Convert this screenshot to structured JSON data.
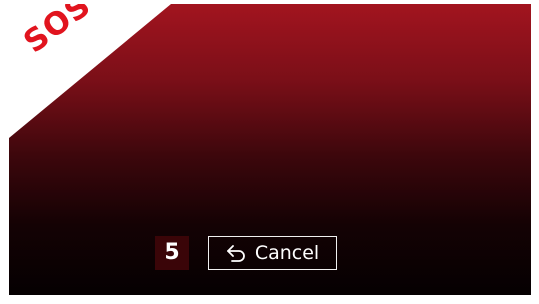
{
  "sos": {
    "label": "SOS",
    "label_color": "#e1141e",
    "banner_color": "#ffffff"
  },
  "countdown": {
    "value": "5"
  },
  "cancel": {
    "label": "Cancel",
    "icon": "undo-arrow-icon"
  },
  "colors": {
    "background_top": "#a2141f",
    "background_bottom": "#050001",
    "text": "#ffffff"
  }
}
